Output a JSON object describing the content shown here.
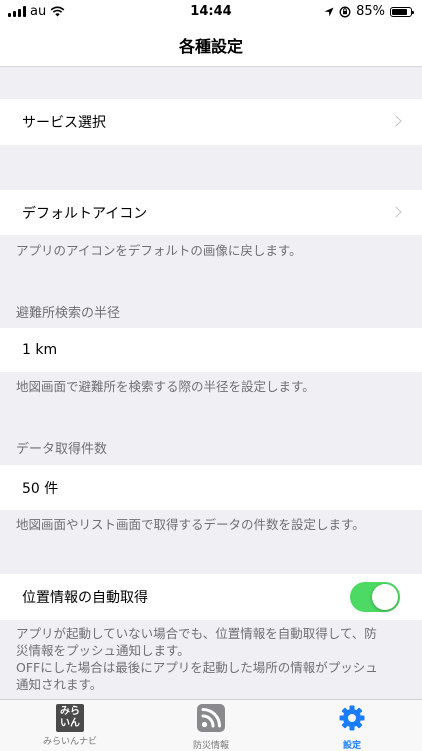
{
  "status": {
    "carrier": "au",
    "time": "14:44",
    "battery": "85%",
    "battery_fraction": 0.85
  },
  "nav": {
    "title": "各種設定"
  },
  "settings": {
    "service_select": {
      "label": "サービス選択"
    },
    "default_icon": {
      "label": "デフォルトアイコン",
      "footnote": "アプリのアイコンをデフォルトの画像に戻します。"
    },
    "search_radius": {
      "header": "避難所検索の半径",
      "value": "1 km",
      "footnote": "地図画面で避難所を検索する際の半径を設定します。"
    },
    "data_count": {
      "header": "データ取得件数",
      "value": "50 件",
      "footnote": "地図画面やリスト画面で取得するデータの件数を設定します。"
    },
    "auto_location": {
      "label": "位置情報の自動取得",
      "enabled": true,
      "toggle_color": "#4cd964",
      "footnote_line1": "アプリが起動していない場合でも、位置情報を自動取得して、防",
      "footnote_line2": "災情報をプッシュ通知します。",
      "footnote_line3": "OFFにした場合は最後にアプリを起動した場所の情報がプッシュ",
      "footnote_line4": "通知されます。"
    }
  },
  "tabs": [
    {
      "label": "みらいんナビ",
      "logo_line1": "みら",
      "logo_line2": "いん",
      "icon": "mirain-logo-icon"
    },
    {
      "label": "防災情報",
      "icon": "rss-feed-icon"
    },
    {
      "label": "設定",
      "icon": "gear-icon",
      "active": true,
      "active_color": "#1a7cff"
    }
  ]
}
